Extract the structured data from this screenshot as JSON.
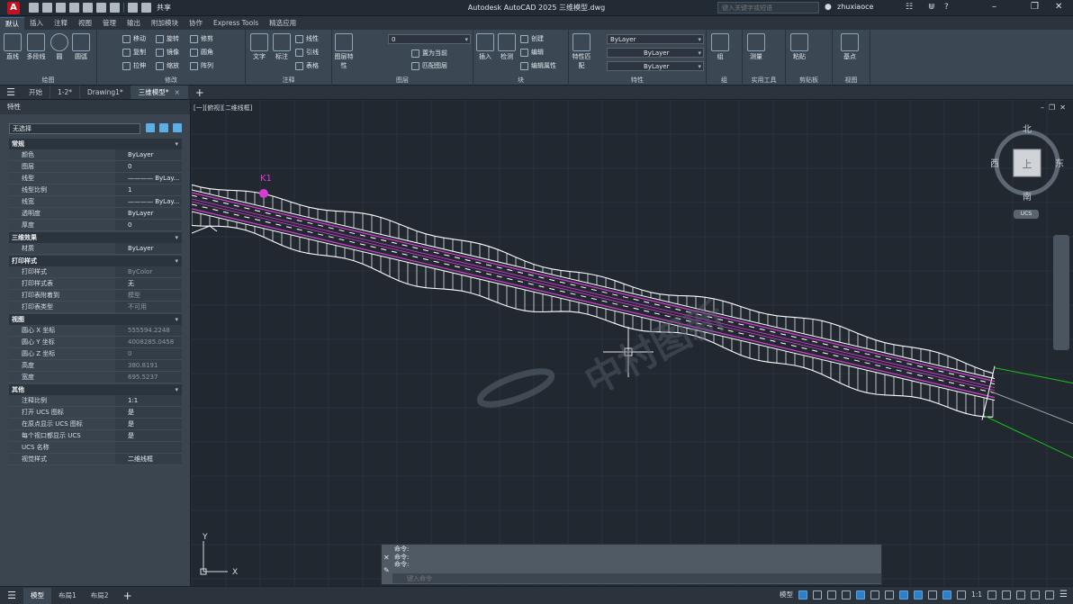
{
  "titlebar": {
    "app_letter": "A",
    "share_label": "共享",
    "title": "Autodesk AutoCAD 2025    三维模型.dwg",
    "search_placeholder": "键入关键字或短语",
    "username": "zhuxiaoce"
  },
  "ribbon_tabs": [
    "默认",
    "插入",
    "注释",
    "视图",
    "管理",
    "输出",
    "附加模块",
    "协作",
    "Express Tools",
    "精选应用"
  ],
  "ribbon": {
    "draw": {
      "title": "绘图",
      "line": "直线",
      "polyline": "多段线",
      "circle": "圆",
      "arc": "圆弧"
    },
    "modify": {
      "title": "修改",
      "move": "移动",
      "rotate": "旋转",
      "trim": "修剪",
      "copy": "复制",
      "mirror": "镜像",
      "fillet": "圆角",
      "stretch": "拉伸",
      "scale": "缩放",
      "array": "阵列"
    },
    "annotation": {
      "title": "注释",
      "text": "文字",
      "dimension": "标注",
      "linear": "线性",
      "leader": "引线",
      "table": "表格"
    },
    "layers": {
      "title": "图层",
      "layer_props": "图层特性",
      "layer_value": "0",
      "make_current": "置为当前",
      "match_layer": "匹配图层"
    },
    "block": {
      "title": "块",
      "insert": "插入",
      "inspect": "检测",
      "create": "创建",
      "edit": "编辑",
      "edit_attr": "编辑属性"
    },
    "properties": {
      "title": "特性",
      "match": "特性匹配",
      "color": "ByLayer",
      "linetype": "ByLayer",
      "lineweight": "ByLayer"
    },
    "groups": {
      "title": "组",
      "group": "组"
    },
    "utilities": {
      "title": "实用工具",
      "measure": "测量"
    },
    "clipboard": {
      "title": "剪贴板",
      "paste": "粘贴"
    },
    "view": {
      "title": "视图",
      "base": "基点"
    }
  },
  "doc_tabs": [
    {
      "label": "开始"
    },
    {
      "label": "1-2*"
    },
    {
      "label": "Drawing1*"
    },
    {
      "label": "三维模型*"
    }
  ],
  "properties_panel": {
    "title": "特性",
    "selection": "无选择",
    "sections": [
      {
        "title": "常规",
        "rows": [
          {
            "k": "颜色",
            "v": "ByLayer"
          },
          {
            "k": "图层",
            "v": "0"
          },
          {
            "k": "线型",
            "v": "———— ByLay..."
          },
          {
            "k": "线型比例",
            "v": "1"
          },
          {
            "k": "线宽",
            "v": "———— ByLay..."
          },
          {
            "k": "透明度",
            "v": "ByLayer"
          },
          {
            "k": "厚度",
            "v": "0"
          }
        ]
      },
      {
        "title": "三维效果",
        "rows": [
          {
            "k": "材质",
            "v": "ByLayer"
          }
        ]
      },
      {
        "title": "打印样式",
        "rows": [
          {
            "k": "打印样式",
            "v": "ByColor",
            "dim": true
          },
          {
            "k": "打印样式表",
            "v": "无"
          },
          {
            "k": "打印表附着到",
            "v": "模型",
            "dim": true
          },
          {
            "k": "打印表类型",
            "v": "不可用",
            "dim": true
          }
        ]
      },
      {
        "title": "视图",
        "rows": [
          {
            "k": "圆心 X 坐标",
            "v": "555594.2248",
            "dim": true
          },
          {
            "k": "圆心 Y 坐标",
            "v": "4008285.0458",
            "dim": true
          },
          {
            "k": "圆心 Z 坐标",
            "v": "0",
            "dim": true
          },
          {
            "k": "高度",
            "v": "380.8191",
            "dim": true
          },
          {
            "k": "宽度",
            "v": "695.5237",
            "dim": true
          }
        ]
      },
      {
        "title": "其他",
        "rows": [
          {
            "k": "注释比例",
            "v": "1:1"
          },
          {
            "k": "打开 UCS 图标",
            "v": "是"
          },
          {
            "k": "在原点显示 UCS 图标",
            "v": "是"
          },
          {
            "k": "每个视口都显示 UCS",
            "v": "是"
          },
          {
            "k": "UCS 名称",
            "v": ""
          },
          {
            "k": "视觉样式",
            "v": "二维线框"
          }
        ]
      }
    ]
  },
  "viewport": {
    "label": "[一][俯视][二维线框]",
    "viewcube": {
      "north": "北",
      "south": "南",
      "east": "东",
      "west": "西",
      "face": "上"
    },
    "ucs_label": "UCS",
    "ucs_x": "X",
    "ucs_y": "Y",
    "watermark": "中村图新",
    "marker": "K1"
  },
  "command": {
    "history": [
      "命令:",
      "命令:",
      "命令:"
    ],
    "placeholder": "键入命令"
  },
  "statusbar": {
    "tabs": [
      "模型",
      "布局1",
      "布局2"
    ],
    "model_label": "模型",
    "scale": "1:1"
  },
  "colors": {
    "road_edge": "#ffffff",
    "magenta": "#d93ad6",
    "green": "#18c218",
    "grid": "#2a323c"
  }
}
